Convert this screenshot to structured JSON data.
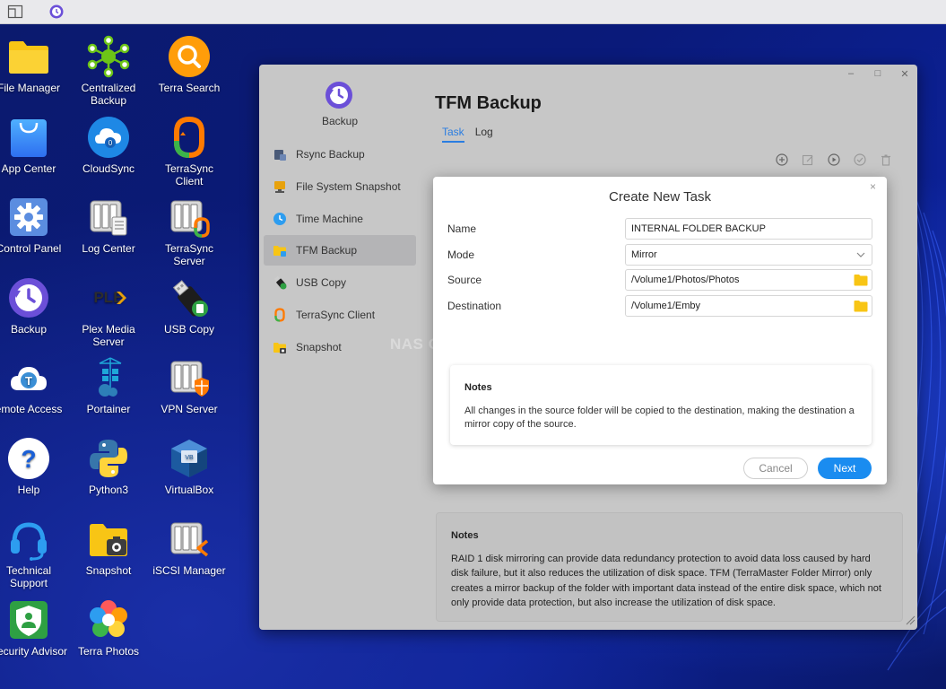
{
  "desktop": {
    "icons": [
      {
        "label": "File Manager",
        "icon": "folder-icon"
      },
      {
        "label": "Centralized Backup",
        "icon": "centralized-backup-icon"
      },
      {
        "label": "Terra Search",
        "icon": "search-icon"
      },
      {
        "label": "App Center",
        "icon": "shopping-bag-icon"
      },
      {
        "label": "CloudSync",
        "icon": "cloud-sync-icon"
      },
      {
        "label": "TerraSync Client",
        "icon": "terrasync-client-icon"
      },
      {
        "label": "Control Panel",
        "icon": "gear-icon"
      },
      {
        "label": "Log Center",
        "icon": "log-center-icon"
      },
      {
        "label": "TerraSync Server",
        "icon": "terrasync-server-icon"
      },
      {
        "label": "Backup",
        "icon": "backup-clock-icon"
      },
      {
        "label": "Plex Media Server",
        "icon": "plex-icon"
      },
      {
        "label": "USB Copy",
        "icon": "usb-drive-icon"
      },
      {
        "label": "emote Access",
        "icon": "remote-access-icon"
      },
      {
        "label": "Portainer",
        "icon": "portainer-icon"
      },
      {
        "label": "VPN Server",
        "icon": "vpn-server-icon"
      },
      {
        "label": "Help",
        "icon": "help-icon"
      },
      {
        "label": "Python3",
        "icon": "python-icon"
      },
      {
        "label": "VirtualBox",
        "icon": "virtualbox-icon"
      },
      {
        "label": "Technical Support",
        "icon": "headset-icon"
      },
      {
        "label": "Snapshot",
        "icon": "snapshot-folder-icon"
      },
      {
        "label": "iSCSI Manager",
        "icon": "iscsi-manager-icon"
      },
      {
        "label": "Security Advisor",
        "icon": "security-advisor-icon"
      },
      {
        "label": "Terra Photos",
        "icon": "terra-photos-icon"
      }
    ]
  },
  "window": {
    "app_name": "Backup",
    "title": "TFM Backup",
    "tabs": [
      {
        "label": "Task",
        "active": true
      },
      {
        "label": "Log",
        "active": false
      }
    ],
    "sidebar": [
      {
        "label": "Rsync Backup",
        "icon": "rsync-icon",
        "active": false
      },
      {
        "label": "File System Snapshot",
        "icon": "file-system-snapshot-icon",
        "active": false
      },
      {
        "label": "Time Machine",
        "icon": "time-machine-icon",
        "active": false
      },
      {
        "label": "TFM Backup",
        "icon": "tfm-backup-icon",
        "active": true
      },
      {
        "label": "USB Copy",
        "icon": "usb-copy-icon",
        "active": false
      },
      {
        "label": "TerraSync Client",
        "icon": "terrasync-icon",
        "active": false
      },
      {
        "label": "Snapshot",
        "icon": "snapshot-icon",
        "active": false
      }
    ],
    "toolbar": [
      "add-icon",
      "edit-icon",
      "run-icon",
      "check-icon",
      "delete-icon"
    ],
    "watermark": "NAS COMPARES",
    "notes": {
      "title": "Notes",
      "text": "RAID 1 disk mirroring can provide data redundancy protection to avoid data loss caused by hard disk failure, but it also reduces the utilization of disk space. TFM (TerraMaster Folder Mirror) only creates a mirror backup of the folder with important data instead of the entire disk space, which not only provide data protection, but also increase the utilization of disk space."
    }
  },
  "dialog": {
    "title": "Create New Task",
    "close": "×",
    "fields": {
      "name": {
        "label": "Name",
        "value": "INTERNAL FOLDER BACKUP"
      },
      "mode": {
        "label": "Mode",
        "value": "Mirror"
      },
      "source": {
        "label": "Source",
        "value": "/Volume1/Photos/Photos"
      },
      "destination": {
        "label": "Destination",
        "value": "/Volume1/Emby"
      }
    },
    "notes": {
      "title": "Notes",
      "text": "All changes in the source folder will be copied to the destination, making the destination a mirror copy of the source."
    },
    "cancel_label": "Cancel",
    "next_label": "Next"
  },
  "colors": {
    "accent": "#1a8cf0",
    "tab_active": "#2a7de1",
    "folder_yellow": "#f8c515",
    "backup_purple": "#6b4fd8"
  }
}
